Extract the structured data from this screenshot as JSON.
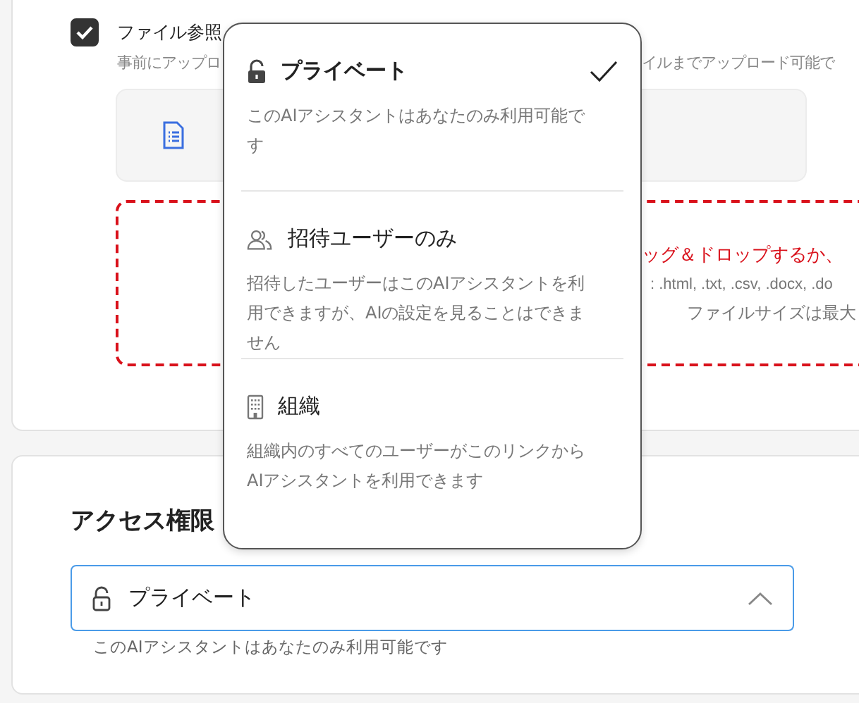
{
  "file_option": {
    "checked": true,
    "label": "ファイル参照",
    "description_left": "事前にアップロ",
    "description_right": "イルまでアップロード可能で"
  },
  "dropzone": {
    "lines": [
      {
        "kind": "prompt",
        "text": "ッグ＆ドロップするか、"
      },
      {
        "kind": "formats",
        "text": ": .html, .txt, .csv, .docx, .do"
      },
      {
        "kind": "size",
        "text": "ファイルサイズは最大"
      }
    ]
  },
  "access": {
    "title": "アクセス権限",
    "select": {
      "value": "プライベート",
      "expanded": true
    },
    "hint": "このAIアシスタントはあなたのみ利用可能です"
  },
  "dropdown": {
    "options": [
      {
        "kind": "lock",
        "label": "プライベート",
        "description": "このAIアシスタントはあなたのみ利用可能です",
        "selected": true
      },
      {
        "kind": "users",
        "label": "招待ユーザーのみ",
        "description": "招待したユーザーはこのAIアシスタントを利用できますが、AIの設定を見ることはできません",
        "selected": false
      },
      {
        "kind": "building",
        "label": "組織",
        "description": "組織内のすべてのユーザーがこのリンクからAIアシスタントを利用できます",
        "selected": false
      }
    ]
  }
}
